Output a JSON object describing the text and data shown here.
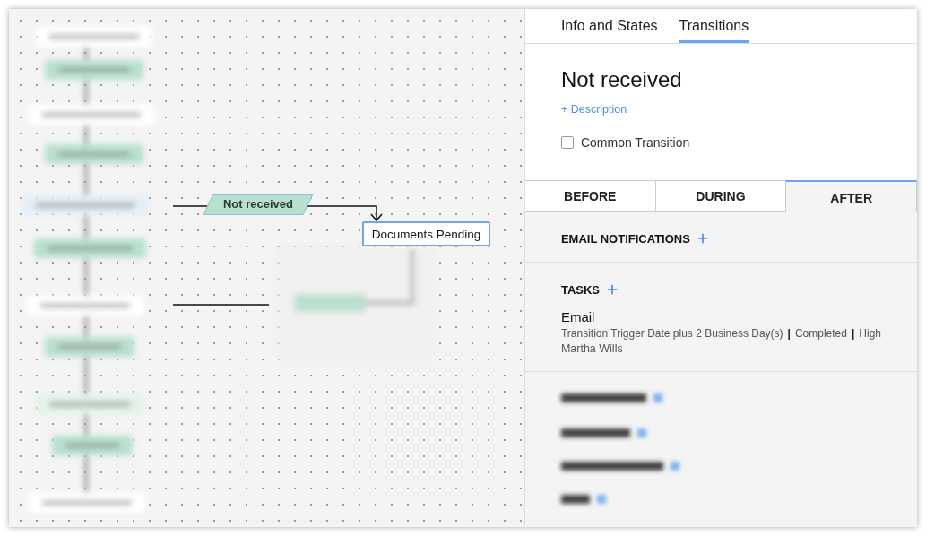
{
  "canvas": {
    "transition_label": "Not received",
    "state_node": "Documents Pending"
  },
  "side_tabs": [
    {
      "label": "Info and States",
      "selected": false
    },
    {
      "label": "Transitions",
      "selected": true
    }
  ],
  "transition": {
    "title": "Not received",
    "description_link": "+ Description",
    "common_transition": {
      "label": "Common Transition",
      "checked": false
    }
  },
  "phase_tabs": [
    {
      "label": "BEFORE",
      "selected": false
    },
    {
      "label": "DURING",
      "selected": false
    },
    {
      "label": "AFTER",
      "selected": true
    }
  ],
  "sections": [
    {
      "title": "EMAIL NOTIFICATIONS"
    },
    {
      "title": "TASKS",
      "items": [
        {
          "name": "Email",
          "details": [
            "Transition Trigger Date plus 2 Business Day(s)",
            "Completed",
            "High"
          ],
          "separator": "|",
          "owner": "Martha Wills"
        }
      ]
    }
  ]
}
